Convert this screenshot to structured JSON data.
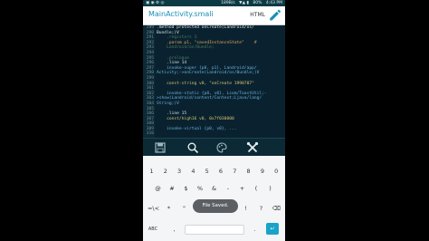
{
  "status_bar": {
    "left": "▣ ◉ ⚙ ◎",
    "network": "189B/s",
    "signal": "▼▲ ▮",
    "battery": "80%",
    "time": "4:43 PM"
  },
  "app_bar": {
    "title": "MainActivity.smali",
    "mode": "HTML",
    "edit_icon": "pencil-icon"
  },
  "editor": {
    "line_numbers": [
      "289",
      "290",
      "291",
      "292",
      "293",
      "294",
      "295",
      "296",
      "297",
      "298",
      "299",
      "300",
      "301",
      "302",
      "303",
      "304",
      "305",
      "306",
      "307",
      "308",
      "309",
      "310"
    ],
    "lines": [
      ".method protected onCreate(Landroid/os/",
      "Bundle;)V",
      "    .registers 3",
      "    .param p1, \"savedInstanceState\"    #",
      "    Landroid/os/Bundle;",
      "",
      "    .prologue",
      "    .line 14",
      "    invoke-super {p0, p1}, Landroid/app/",
      "Activity;->onCreate(Landroid/os/Bundle;)V",
      "",
      "    const-string v0, \"onCreate 1990707\"",
      "",
      "    invoke-static {p0, v0}, Lcom/ToastUtil;-",
      ">show(Landroid/content/Context;Ljava/lang/",
      "String;)V",
      "",
      "    .line 15",
      "    const/high16 v0, 0x7f030000",
      "",
      "    invoke-virtual {p0, v0}, ...",
      ""
    ]
  },
  "toolbar": {
    "items": [
      "save-icon",
      "search-icon",
      "palette-icon",
      "tools-icon"
    ]
  },
  "keyboard": {
    "row1": [
      "1",
      "2",
      "3",
      "4",
      "5",
      "6",
      "7",
      "8",
      "9",
      "0"
    ],
    "row2": [
      "@",
      "#",
      "$",
      "%",
      "&",
      "-",
      "+",
      "(",
      ")"
    ],
    "row3": [
      "=\\<",
      "*",
      "\"",
      "'",
      ":",
      ";",
      "!",
      "?",
      "⌫"
    ],
    "row4_left": "ABC",
    "row4_comma": ",",
    "row4_period": ".",
    "enter": "↵"
  },
  "toast": "File Saved.",
  "colors": {
    "status_bar": "#0c3a44",
    "accent": "#1a8fb5",
    "editor_bg": "#0a2230",
    "enter_key": "#1aa3c9"
  }
}
